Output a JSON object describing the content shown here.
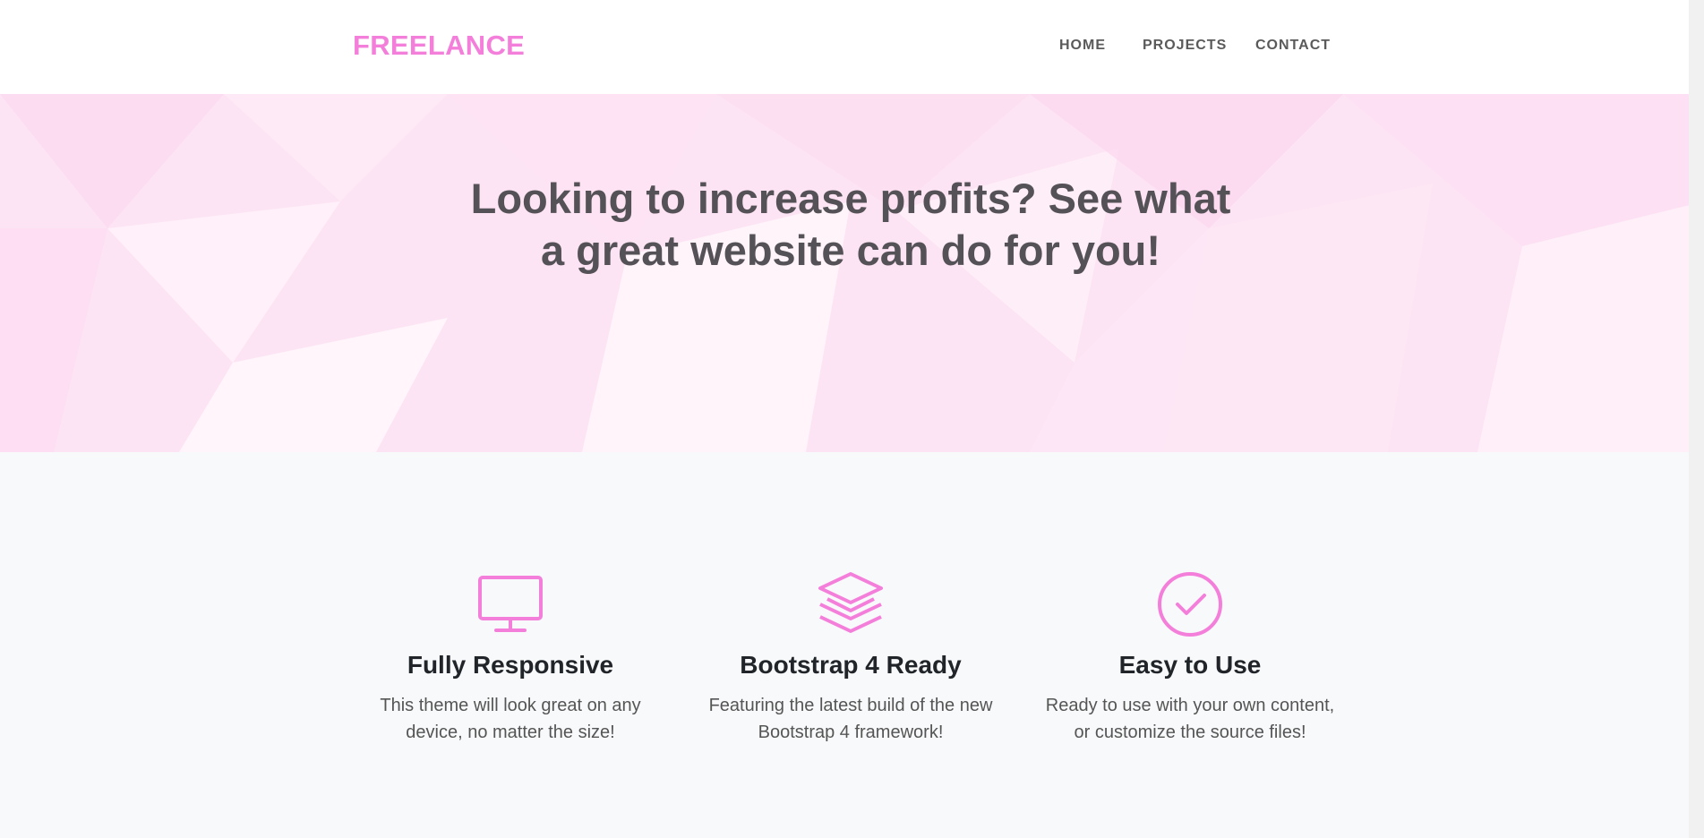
{
  "navbar": {
    "brand": "FREELANCE",
    "links": [
      "HOME",
      "PROJECTS",
      "CONTACT"
    ]
  },
  "hero": {
    "title_line1": "Looking to increase profits? See what",
    "title_line2": "a great website can do for you!"
  },
  "features": [
    {
      "icon": "monitor-icon",
      "title": "Fully Responsive",
      "line1": "This theme will look great on any",
      "line2": "device, no matter the size!"
    },
    {
      "icon": "layers-icon",
      "title": "Bootstrap 4 Ready",
      "line1": "Featuring the latest build of the new",
      "line2": "Bootstrap 4 framework!"
    },
    {
      "icon": "check-circle-icon",
      "title": "Easy to Use",
      "line1": "Ready to use with your own content,",
      "line2": "or customize the source files!"
    }
  ],
  "colors": {
    "brand": "#f47fdb",
    "hero_bg": "#fde4f4",
    "text_dark": "#212529",
    "features_bg": "#f8f9fa"
  }
}
